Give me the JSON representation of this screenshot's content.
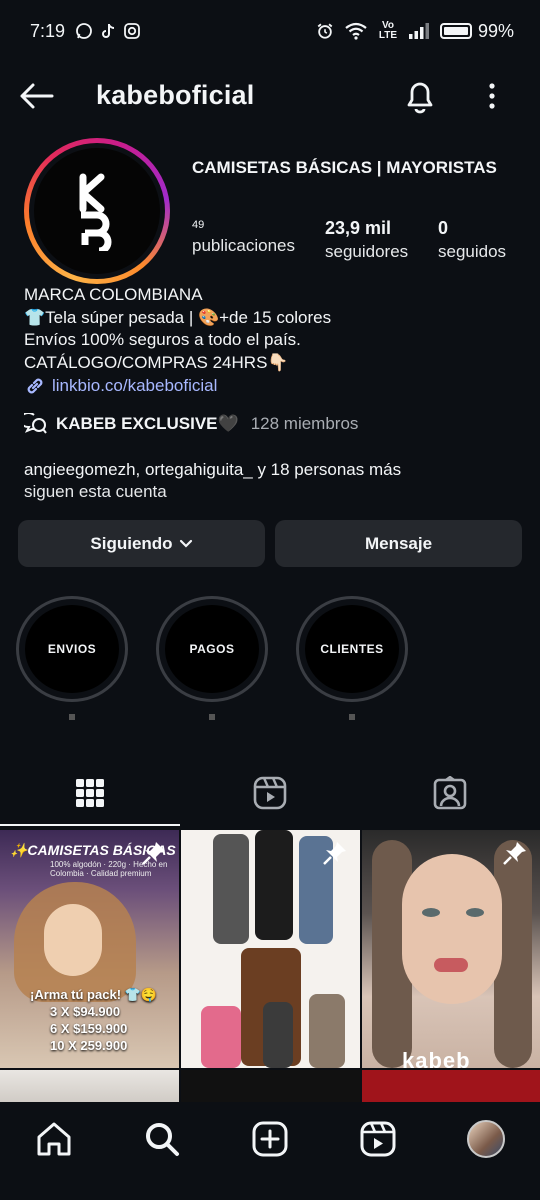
{
  "status_bar": {
    "time": "7:19",
    "network": "Vo LTE",
    "battery": "99%"
  },
  "header": {
    "username": "kabeboficial"
  },
  "profile": {
    "avatar_logo": "KB",
    "display_name": "CAMISETAS BÁSICAS | MAYORISTAS",
    "stats": {
      "posts_count": "49",
      "posts_label": "publicaciones",
      "followers_count": "23,9 mil",
      "followers_label": "seguidores",
      "following_count": "0",
      "following_label": "seguidos"
    },
    "bio": {
      "line1": "MARCA COLOMBIANA",
      "line2": "👕Tela súper pesada | 🎨+de 15 colores",
      "line3": "Envíos 100% seguros a todo el país.",
      "line4": "CATÁLOGO/COMPRAS 24HRS👇🏻",
      "link": "linkbio.co/kabeboficial"
    },
    "channel": {
      "name": "KABEB EXCLUSIVE🖤",
      "members": "128 miembros"
    },
    "followed_by": {
      "names": "angieegomezh, ortegahiguita_ y 18 personas más",
      "suffix": "siguen esta cuenta"
    }
  },
  "actions": {
    "following_label": "Siguiendo",
    "message_label": "Mensaje"
  },
  "highlights": [
    {
      "label": "ENVIOS"
    },
    {
      "label": "PAGOS"
    },
    {
      "label": "CLIENTES"
    }
  ],
  "tabs": [
    {
      "icon": "grid-icon",
      "active": true
    },
    {
      "icon": "reels-icon",
      "active": false
    },
    {
      "icon": "tagged-icon",
      "active": false
    }
  ],
  "posts": {
    "post1": {
      "title": "✨CAMISETAS BÁSICAS",
      "subtitle": "100% algodón · 220g · Hecho en Colombia · Calidad premium",
      "offer_heading": "¡Arma tú pack! 👕🤤",
      "offer_1": "3 X $94.900",
      "offer_2": "6 X $159.900",
      "offer_3": "10 X 259.900"
    },
    "post3": {
      "brand": "kabeb"
    }
  },
  "bottom_nav": [
    {
      "icon": "home-icon"
    },
    {
      "icon": "search-icon"
    },
    {
      "icon": "create-icon"
    },
    {
      "icon": "reels-icon"
    },
    {
      "icon": "profile-avatar"
    }
  ],
  "colors": {
    "background": "#0c0f14",
    "button": "#25282d",
    "link": "#a8b8ff"
  }
}
